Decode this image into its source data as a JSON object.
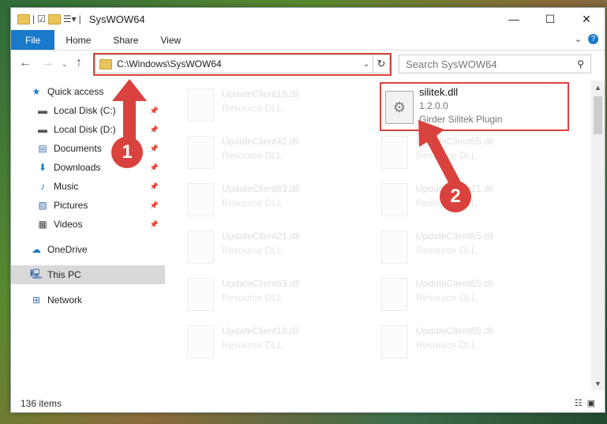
{
  "window": {
    "title": "SysWOW64"
  },
  "ribbon": {
    "tabs": [
      "File",
      "Home",
      "Share",
      "View"
    ]
  },
  "address": {
    "path": "C:\\Windows\\SysWOW64"
  },
  "search": {
    "placeholder": "Search SysWOW64"
  },
  "sidebar": {
    "items": [
      {
        "label": "Quick access",
        "icon": "star-icon"
      },
      {
        "label": "Local Disk (C:)",
        "icon": "drive-icon"
      },
      {
        "label": "Local Disk (D:)",
        "icon": "drive-icon"
      },
      {
        "label": "Documents",
        "icon": "documents-icon"
      },
      {
        "label": "Downloads",
        "icon": "download-icon"
      },
      {
        "label": "Music",
        "icon": "music-icon"
      },
      {
        "label": "Pictures",
        "icon": "pictures-icon"
      },
      {
        "label": "Videos",
        "icon": "videos-icon"
      },
      {
        "label": "OneDrive",
        "icon": "cloud-icon"
      },
      {
        "label": "This PC",
        "icon": "computer-icon"
      },
      {
        "label": "Network",
        "icon": "network-icon"
      }
    ]
  },
  "files_left": [
    {
      "name": "UpdateClient19.dll",
      "desc": "Resource DLL"
    },
    {
      "name": "UpdateClient42.dll",
      "desc": "Resource DLL"
    },
    {
      "name": "UpdateClient63.dll",
      "desc": "Resource DLL"
    },
    {
      "name": "UpdateClient21.dll",
      "desc": "Resource DLL"
    },
    {
      "name": "UpdateClient63.dll",
      "desc": "Resource DLL"
    },
    {
      "name": "UpdateClient19.dll",
      "desc": "Resource DLL"
    }
  ],
  "files_right": [
    {
      "name": "UpdateClient65.dll",
      "desc": "Resource DLL"
    },
    {
      "name": "UpdateClient21.dll",
      "desc": "Resource DLL"
    },
    {
      "name": "UpdateClient65.dll",
      "desc": "Resource DLL"
    },
    {
      "name": "UpdateClient65.dll",
      "desc": "Resource DLL"
    },
    {
      "name": "UpdateClient65.dll",
      "desc": "Resource DLL"
    }
  ],
  "highlighted": {
    "name": "silitek.dll",
    "version": "1.2.0.0",
    "description": "Girder Silitek Plugin"
  },
  "status": {
    "count": "136 items"
  },
  "annotations": {
    "step1": "1",
    "step2": "2"
  },
  "colors": {
    "accent": "#1979ca",
    "highlight": "#d9423d"
  }
}
